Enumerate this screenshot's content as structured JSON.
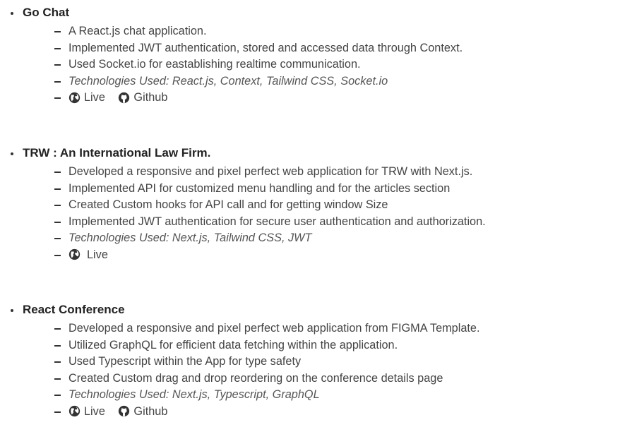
{
  "projects": [
    {
      "title": "Go Chat",
      "items": [
        "A React.js chat application.",
        "Implemented JWT authentication, stored and accessed data through Context.",
        "Used Socket.io for eastablishing realtime communication."
      ],
      "technologies": "Technologies Used: React.js, Context, Tailwind CSS, Socket.io",
      "links": {
        "live": "Live",
        "github": "Github"
      }
    },
    {
      "title": "TRW : An International Law Firm.",
      "items": [
        "Developed a responsive and pixel perfect web application for TRW with Next.js.",
        "Implemented API for customized menu handling and for the articles section",
        "Created Custom hooks for API call and for getting window Size",
        "Implemented JWT authentication for secure user authentication and authorization."
      ],
      "technologies": "Technologies Used: Next.js, Tailwind CSS, JWT",
      "links": {
        "live": "Live"
      }
    },
    {
      "title": "React Conference",
      "items": [
        "Developed a responsive and pixel perfect web application from FIGMA Template.",
        "Utilized GraphQL for efficient data fetching within the application.",
        "Used Typescript within the App for type safety",
        "Created Custom drag and drop reordering on the conference details page"
      ],
      "technologies": "Technologies Used: Next.js, Typescript, GraphQL",
      "links": {
        "live": "Live",
        "github": "Github"
      }
    }
  ],
  "icons": {
    "live": "globe-icon",
    "github": "github-icon"
  }
}
